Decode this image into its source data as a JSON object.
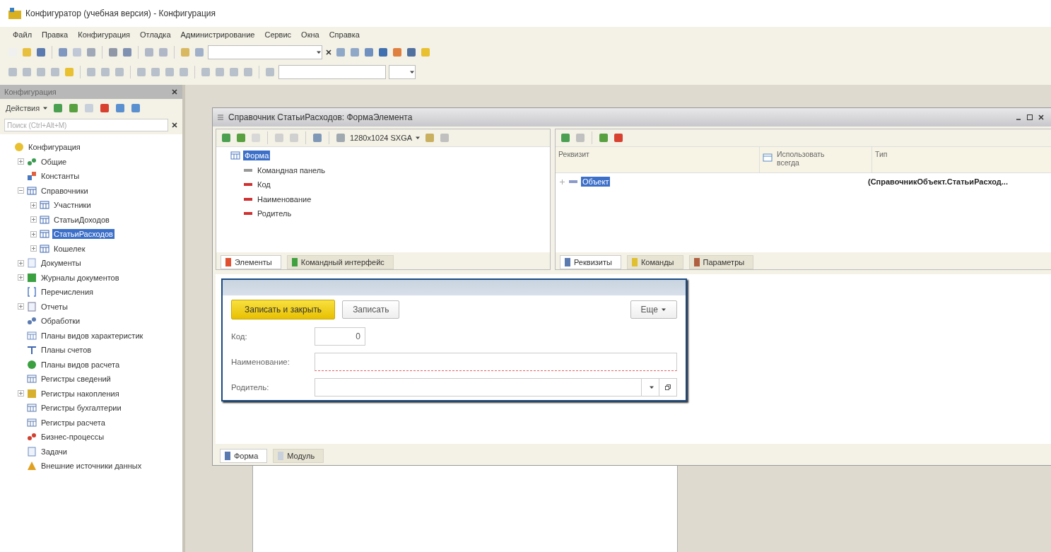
{
  "window": {
    "title": "Конфигуратор (учебная версия) - Конфигурация"
  },
  "menu": [
    "Файл",
    "Правка",
    "Конфигурация",
    "Отладка",
    "Администрирование",
    "Сервис",
    "Окна",
    "Справка"
  ],
  "config_panel": {
    "title": "Конфигурация",
    "actions_label": "Действия",
    "search": {
      "placeholder": "Поиск (Ctrl+Alt+M)"
    },
    "tree": [
      {
        "label": "Конфигурация",
        "kind": "root",
        "selected": false,
        "children": [
          {
            "label": "Общие",
            "kind": "common",
            "expanded": false,
            "selected": false
          },
          {
            "label": "Константы",
            "kind": "constants",
            "selected": false
          },
          {
            "label": "Справочники",
            "kind": "catalogs",
            "expanded": true,
            "selected": false,
            "children": [
              {
                "label": "Участники",
                "kind": "catalog",
                "expanded": false,
                "selected": false
              },
              {
                "label": "СтатьиДоходов",
                "kind": "catalog",
                "expanded": false,
                "selected": false
              },
              {
                "label": "СтатьиРасходов",
                "kind": "catalog",
                "expanded": false,
                "selected": true
              },
              {
                "label": "Кошелек",
                "kind": "catalog",
                "expanded": false,
                "selected": false
              }
            ]
          },
          {
            "label": "Документы",
            "kind": "documents",
            "expanded": false,
            "selected": false
          },
          {
            "label": "Журналы документов",
            "kind": "journals",
            "expanded": false,
            "selected": false
          },
          {
            "label": "Перечисления",
            "kind": "enums",
            "selected": false
          },
          {
            "label": "Отчеты",
            "kind": "reports",
            "expanded": false,
            "selected": false
          },
          {
            "label": "Обработки",
            "kind": "processing",
            "selected": false
          },
          {
            "label": "Планы видов характеристик",
            "kind": "chart",
            "selected": false
          },
          {
            "label": "Планы счетов",
            "kind": "accounts",
            "selected": false
          },
          {
            "label": "Планы видов расчета",
            "kind": "calc",
            "selected": false
          },
          {
            "label": "Регистры сведений",
            "kind": "register",
            "selected": false
          },
          {
            "label": "Регистры накопления",
            "kind": "accum",
            "expanded": false,
            "selected": false
          },
          {
            "label": "Регистры бухгалтерии",
            "kind": "register",
            "selected": false
          },
          {
            "label": "Регистры расчета",
            "kind": "register",
            "selected": false
          },
          {
            "label": "Бизнес-процессы",
            "kind": "process",
            "selected": false
          },
          {
            "label": "Задачи",
            "kind": "tasks",
            "selected": false
          },
          {
            "label": "Внешние источники данных",
            "kind": "external",
            "selected": false
          }
        ]
      }
    ]
  },
  "form_window": {
    "title": "Справочник СтатьиРасходов: ФормаЭлемента",
    "resolution": "1280x1024 SXGA",
    "elements_tree": [
      {
        "label": "Форма",
        "kind": "form",
        "selected": true,
        "children": [
          {
            "label": "Командная панель",
            "kind": "panel",
            "selected": false
          },
          {
            "label": "Код",
            "kind": "field",
            "selected": false
          },
          {
            "label": "Наименование",
            "kind": "field",
            "selected": false
          },
          {
            "label": "Родитель",
            "kind": "field",
            "selected": false
          }
        ]
      }
    ],
    "left_tabs": [
      {
        "label": "Элементы",
        "selected": true
      },
      {
        "label": "Командный интерфейс",
        "selected": false
      }
    ],
    "attributes_table": {
      "columns": [
        "Реквизит",
        "Использовать всегда",
        "Тип"
      ],
      "rows": [
        {
          "name": "Объект",
          "selected": true,
          "expanded": false,
          "type": "(СправочникОбъект.СтатьиРасход..."
        }
      ]
    },
    "right_tabs": [
      {
        "label": "Реквизиты",
        "selected": true
      },
      {
        "label": "Команды",
        "selected": false
      },
      {
        "label": "Параметры",
        "selected": false
      }
    ],
    "preview": {
      "buttons": [
        {
          "label": "Записать и закрыть",
          "kind": "default"
        },
        {
          "label": "Записать",
          "kind": "normal"
        }
      ],
      "more_button": "Еще",
      "fields": [
        {
          "label": "Код:",
          "kind": "number",
          "value": "0"
        },
        {
          "label": "Наименование:",
          "kind": "text",
          "required": true
        },
        {
          "label": "Родитель:",
          "kind": "choice",
          "required": false
        }
      ]
    },
    "bottom_tabs": [
      {
        "label": "Форма",
        "selected": true
      },
      {
        "label": "Модуль",
        "selected": false
      }
    ]
  }
}
